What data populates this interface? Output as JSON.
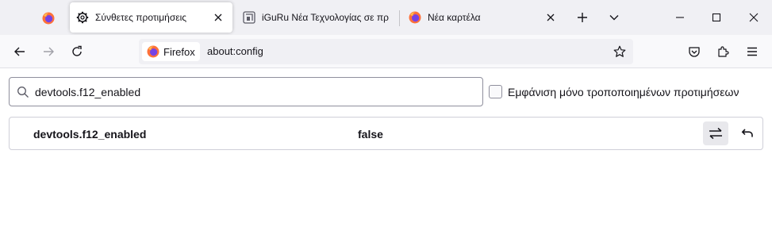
{
  "tabs": [
    {
      "title": "Σύνθετες προτιμήσεις",
      "icon": "gear-icon",
      "active": true
    },
    {
      "title": "iGuRu Νέα Τεχνολογίας σε πραγματικό χρόνο",
      "icon": "iguru-icon",
      "active": false
    },
    {
      "title": "Νέα καρτέλα",
      "icon": "firefox-icon",
      "active": false
    }
  ],
  "navbar": {
    "identity_label": "Firefox",
    "url": "about:config"
  },
  "search": {
    "value": "devtools.f12_enabled"
  },
  "filter": {
    "label": "Εμφάνιση μόνο τροποποιημένων προτιμήσεων",
    "checked": false
  },
  "preference": {
    "name": "devtools.f12_enabled",
    "value": "false"
  },
  "colors": {
    "tabstrip_bg": "#f0f0f4",
    "navbar_bg": "#f9f9fb",
    "firefox_orange": "#ff7139",
    "firefox_purple": "#7542e5"
  }
}
